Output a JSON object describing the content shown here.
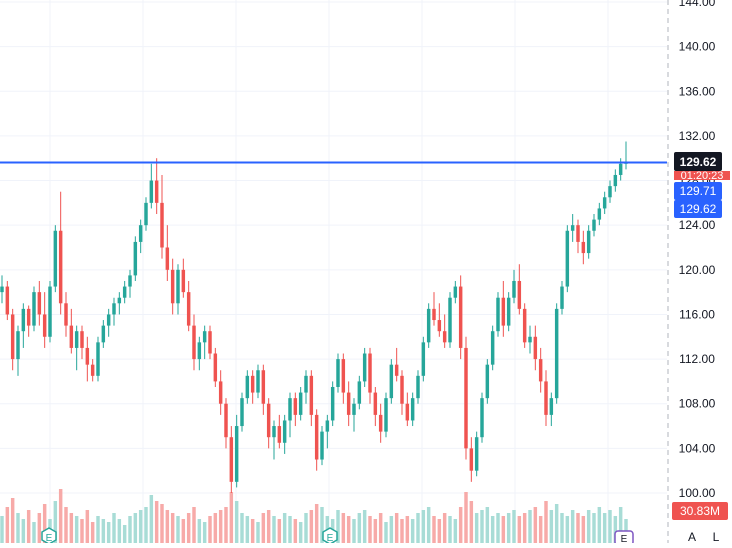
{
  "chart_data": {
    "type": "candlestick",
    "y_axis_position": "right",
    "ylim": [
      99,
      144
    ],
    "ticks": [
      "144.00",
      "140.00",
      "136.00",
      "132.00",
      "128.00",
      "124.00",
      "120.00",
      "116.00",
      "112.00",
      "108.00",
      "104.00",
      "100.00"
    ],
    "tick_values": [
      144,
      140,
      136,
      132,
      128,
      124,
      120,
      116,
      112,
      108,
      104,
      100
    ],
    "colors": {
      "up": "#26a69a",
      "down": "#ef5350",
      "up_vol": "#a8dcd6",
      "down_vol": "#f7aaa8",
      "line": "#2962ff",
      "grid": "#f0f3fa",
      "axis_text": "#131722"
    },
    "price_line": {
      "value": 129.62
    },
    "labels": {
      "last_price": "129.62",
      "countdown": "01:20:23",
      "ask": "129.71",
      "bid": "129.62",
      "volume": "30.83M"
    },
    "earnings_markers": [
      "E",
      "E",
      "E"
    ],
    "bottom_icons": [
      "A",
      "L"
    ],
    "candles": [
      [
        118,
        119.5,
        117,
        118.5
      ],
      [
        118.5,
        119,
        115.5,
        116
      ],
      [
        116,
        116.5,
        111,
        112
      ],
      [
        112,
        115,
        110.5,
        114.5
      ],
      [
        114.5,
        117,
        113,
        116.5
      ],
      [
        116.5,
        116.8,
        114,
        115
      ],
      [
        115,
        118.5,
        114.5,
        118
      ],
      [
        118,
        119,
        115,
        116
      ],
      [
        116,
        118,
        113,
        114
      ],
      [
        114,
        119,
        113.5,
        118.5
      ],
      [
        118.5,
        124,
        118,
        123.5
      ],
      [
        123.5,
        127,
        116,
        117
      ],
      [
        117,
        118,
        114,
        115
      ],
      [
        115,
        116.5,
        112.5,
        113
      ],
      [
        113,
        115,
        111,
        114.5
      ],
      [
        114.5,
        115,
        112,
        113
      ],
      [
        113,
        114,
        110,
        111.5
      ],
      [
        111.5,
        112,
        110,
        110.5
      ],
      [
        110.5,
        114,
        110,
        113.5
      ],
      [
        113.5,
        115.5,
        113,
        115
      ],
      [
        115,
        116.5,
        114,
        116
      ],
      [
        116,
        117.5,
        115,
        117
      ],
      [
        117,
        118,
        116,
        117.5
      ],
      [
        117.5,
        119,
        117,
        118.5
      ],
      [
        118.5,
        120,
        117.5,
        119.5
      ],
      [
        119.5,
        123,
        119,
        122.5
      ],
      [
        122.5,
        124.5,
        121.5,
        124
      ],
      [
        124,
        126.5,
        123.5,
        126
      ],
      [
        126,
        129.5,
        125.5,
        128
      ],
      [
        128,
        130,
        125,
        126
      ],
      [
        126,
        128.5,
        121,
        122
      ],
      [
        122,
        124,
        119,
        120
      ],
      [
        120,
        121,
        116,
        117
      ],
      [
        117,
        120.5,
        116,
        120
      ],
      [
        120,
        121,
        117.5,
        118
      ],
      [
        118,
        119,
        114.5,
        115
      ],
      [
        115,
        116,
        111,
        112
      ],
      [
        112,
        114,
        111,
        113.5
      ],
      [
        113.5,
        115,
        112,
        114.5
      ],
      [
        114.5,
        115,
        112,
        112.5
      ],
      [
        112.5,
        113,
        109.5,
        110
      ],
      [
        110,
        111,
        107,
        108
      ],
      [
        108,
        108.5,
        104,
        105
      ],
      [
        105,
        106,
        100,
        101
      ],
      [
        101,
        107,
        100.5,
        106
      ],
      [
        106,
        109,
        105.5,
        108.5
      ],
      [
        108.5,
        111,
        108,
        110.5
      ],
      [
        110.5,
        111,
        108,
        109
      ],
      [
        109,
        111.5,
        108.5,
        111
      ],
      [
        111,
        111.5,
        107,
        108
      ],
      [
        108,
        108.5,
        104,
        105
      ],
      [
        105,
        106.5,
        103,
        106
      ],
      [
        106,
        107,
        104,
        104.5
      ],
      [
        104.5,
        107,
        103.5,
        106.5
      ],
      [
        106.5,
        109,
        105,
        108.5
      ],
      [
        108.5,
        109,
        106,
        107
      ],
      [
        107,
        109.5,
        106.5,
        109
      ],
      [
        109,
        111,
        108,
        110.5
      ],
      [
        110.5,
        111,
        106,
        107
      ],
      [
        107,
        107.5,
        102,
        103
      ],
      [
        103,
        106,
        102.5,
        105.5
      ],
      [
        105.5,
        107,
        104,
        106.5
      ],
      [
        106.5,
        110,
        106,
        109.5
      ],
      [
        109.5,
        112.5,
        109,
        112
      ],
      [
        112,
        112.5,
        108,
        109
      ],
      [
        109,
        110,
        106,
        107
      ],
      [
        107,
        108.5,
        105.5,
        108
      ],
      [
        108,
        110.5,
        107.5,
        110
      ],
      [
        110,
        113,
        109.5,
        112.5
      ],
      [
        112.5,
        113,
        108,
        109
      ],
      [
        109,
        109.5,
        106,
        107
      ],
      [
        107,
        108,
        104.5,
        105.5
      ],
      [
        105.5,
        109,
        105,
        108.5
      ],
      [
        108.5,
        112,
        108,
        111.5
      ],
      [
        111.5,
        113,
        110,
        110.5
      ],
      [
        110.5,
        111,
        107,
        108
      ],
      [
        108,
        109,
        106,
        106.5
      ],
      [
        106.5,
        109,
        106,
        108.5
      ],
      [
        108.5,
        111,
        108,
        110.5
      ],
      [
        110.5,
        114,
        110,
        113.5
      ],
      [
        113.5,
        117,
        113,
        116.5
      ],
      [
        116.5,
        118,
        115,
        115.5
      ],
      [
        115.5,
        117,
        114,
        114.5
      ],
      [
        114.5,
        116,
        113,
        113.5
      ],
      [
        113.5,
        118,
        113,
        117.5
      ],
      [
        117.5,
        119,
        117,
        118.5
      ],
      [
        118.5,
        119.5,
        112,
        113
      ],
      [
        113,
        114,
        103,
        104
      ],
      [
        104,
        105,
        101,
        102
      ],
      [
        102,
        105.5,
        101.5,
        105
      ],
      [
        105,
        109,
        104.5,
        108.5
      ],
      [
        108.5,
        112,
        108,
        111.5
      ],
      [
        111.5,
        115,
        111,
        114.5
      ],
      [
        114.5,
        118,
        114,
        117.5
      ],
      [
        117.5,
        119,
        114,
        115
      ],
      [
        115,
        118,
        114.5,
        117.5
      ],
      [
        117.5,
        120,
        117,
        119
      ],
      [
        119,
        120.5,
        116,
        116.5
      ],
      [
        116.5,
        117,
        113,
        113.5
      ],
      [
        113.5,
        115,
        112.5,
        114
      ],
      [
        114,
        115,
        111,
        112
      ],
      [
        112,
        113,
        109,
        110
      ],
      [
        110,
        111,
        106,
        107
      ],
      [
        107,
        109,
        106,
        108.5
      ],
      [
        108.5,
        117,
        108,
        116.5
      ],
      [
        116.5,
        119,
        116,
        118.5
      ],
      [
        118.5,
        124,
        118,
        123.5
      ],
      [
        123.5,
        125,
        122.5,
        124
      ],
      [
        124,
        124.5,
        121.5,
        122.5
      ],
      [
        122.5,
        123.5,
        120.5,
        121.5
      ],
      [
        121.5,
        124,
        121,
        123.5
      ],
      [
        123.5,
        125,
        123,
        124.5
      ],
      [
        124.5,
        126,
        124,
        125.5
      ],
      [
        125.5,
        127,
        125,
        126.5
      ],
      [
        126.5,
        128,
        126,
        127.5
      ],
      [
        127.5,
        129,
        127,
        128.5
      ],
      [
        128.5,
        130,
        128,
        129.5
      ],
      [
        129.5,
        131.5,
        129,
        129.62
      ]
    ],
    "volumes": [
      0.45,
      0.6,
      0.75,
      0.5,
      0.4,
      0.55,
      0.35,
      0.5,
      0.65,
      0.4,
      0.7,
      0.9,
      0.6,
      0.5,
      0.45,
      0.4,
      0.55,
      0.35,
      0.45,
      0.4,
      0.35,
      0.5,
      0.4,
      0.3,
      0.45,
      0.5,
      0.55,
      0.6,
      0.8,
      0.7,
      0.65,
      0.55,
      0.5,
      0.45,
      0.4,
      0.5,
      0.6,
      0.4,
      0.35,
      0.45,
      0.5,
      0.55,
      0.6,
      0.85,
      0.7,
      0.5,
      0.45,
      0.4,
      0.35,
      0.5,
      0.55,
      0.45,
      0.4,
      0.5,
      0.45,
      0.4,
      0.35,
      0.5,
      0.55,
      0.65,
      0.6,
      0.45,
      0.4,
      0.55,
      0.5,
      0.45,
      0.4,
      0.5,
      0.55,
      0.45,
      0.4,
      0.5,
      0.35,
      0.45,
      0.5,
      0.4,
      0.45,
      0.4,
      0.5,
      0.55,
      0.6,
      0.45,
      0.4,
      0.5,
      0.45,
      0.4,
      0.6,
      0.85,
      0.7,
      0.5,
      0.55,
      0.6,
      0.45,
      0.5,
      0.45,
      0.5,
      0.55,
      0.45,
      0.5,
      0.55,
      0.6,
      0.45,
      0.7,
      0.55,
      0.65,
      0.5,
      0.45,
      0.55,
      0.5,
      0.45,
      0.55,
      0.5,
      0.6,
      0.5,
      0.55,
      0.45,
      0.6
    ]
  }
}
